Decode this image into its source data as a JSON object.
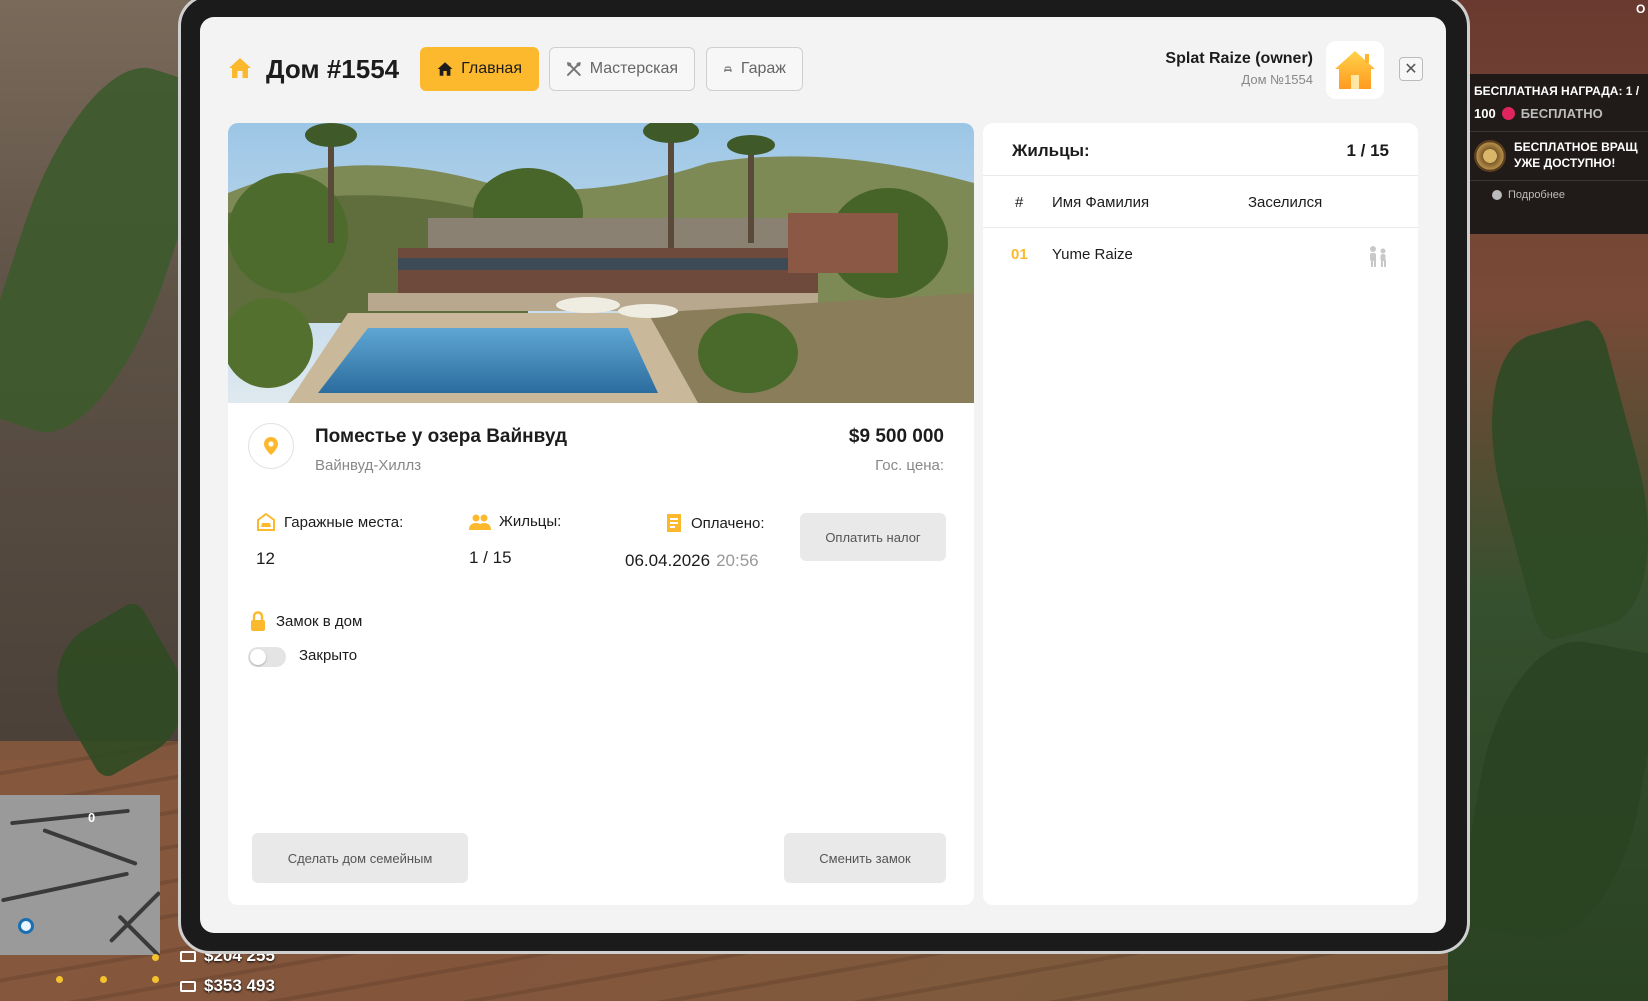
{
  "header": {
    "title": "Дом #1554",
    "tabs": [
      {
        "label": "Главная",
        "icon": "home-icon",
        "active": true
      },
      {
        "label": "Мастерская",
        "icon": "tools-icon",
        "active": false
      },
      {
        "label": "Гараж",
        "icon": "car-icon",
        "active": false
      }
    ],
    "owner_name": "Splat Raize (owner)",
    "owner_sub": "Дом №1554",
    "close_label": "✕"
  },
  "house": {
    "name": "Поместье у озера Вайнвуд",
    "location": "Вайнвуд-Хиллз",
    "price": "$9 500 000",
    "price_label": "Гос. цена:",
    "stats": {
      "garage_label": "Гаражные места:",
      "garage_value": "12",
      "residents_label": "Жильцы:",
      "residents_value": "1 / 15",
      "paid_label": "Оплачено:",
      "paid_date": "06.04.2026",
      "paid_time": "20:56"
    },
    "pay_tax_label": "Оплатить налог",
    "lock_label": "Замок в дом",
    "lock_state_label": "Закрыто",
    "lock_open": false,
    "family_button": "Сделать дом семейным",
    "change_lock_button": "Сменить замок"
  },
  "residents": {
    "title": "Жильцы:",
    "count": "1 / 15",
    "columns": [
      "#",
      "Имя Фамилия",
      "Заселился"
    ],
    "rows": [
      {
        "num": "01",
        "name": "Yume Raize",
        "moved_in": ""
      }
    ]
  },
  "hud": {
    "reward_text": "БЕСПЛАТНАЯ НАГРАДА: 1 /",
    "reward_amount": "100",
    "reward_free": "БЕСПЛАТНО",
    "spin_line1": "БЕСПЛАТНОЕ ВРАЩ",
    "spin_line2": "УЖЕ ДОСТУПНО!",
    "more_label": "Подробнее",
    "money_1": "$204 255",
    "money_2": "$353 493",
    "minimap_value": "0",
    "top_right_char": "O"
  },
  "colors": {
    "accent": "#fdb92e",
    "text": "#1c1c1c",
    "muted": "#888888",
    "panel": "#f3f3f3",
    "coin": "#e0245e"
  }
}
